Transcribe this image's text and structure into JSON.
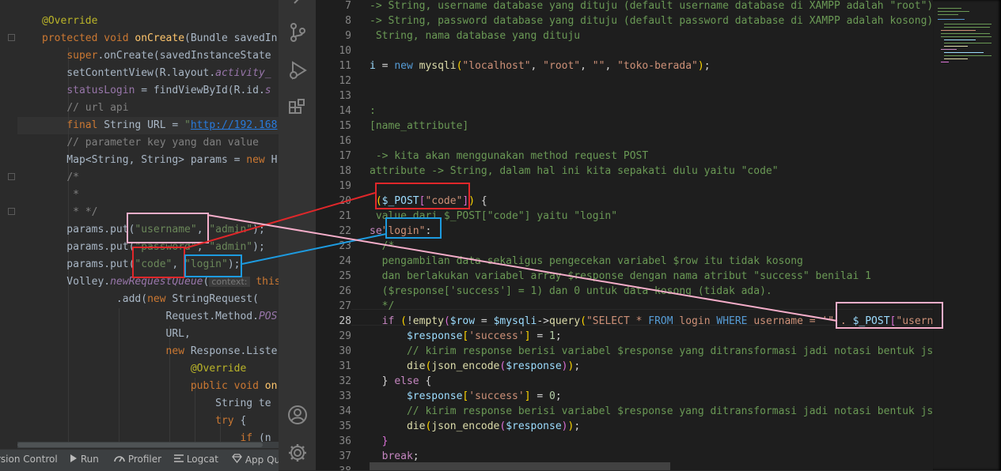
{
  "left_editor": {
    "lines": [
      {
        "segments": [
          [
            "l-ann",
            "@Override"
          ]
        ]
      },
      {
        "segments": [
          [
            "l-kw",
            "protected void "
          ],
          [
            "l-fn",
            "onCreate"
          ],
          [
            "",
            "(Bundle savedIn"
          ]
        ]
      },
      {
        "segments": [
          [
            "",
            "    "
          ],
          [
            "l-kw",
            "super"
          ],
          [
            "",
            ".onCreate(savedInstanceState"
          ]
        ]
      },
      {
        "segments": [
          [
            "",
            "    setContentView(R.layout."
          ],
          [
            "l-it",
            "activity_"
          ]
        ]
      },
      {
        "segments": [
          [
            "",
            "    "
          ],
          [
            "l-fld",
            "statusLogin"
          ],
          [
            "",
            " = findViewById(R.id."
          ],
          [
            "l-it",
            "s"
          ]
        ]
      },
      {
        "segments": [
          [
            "",
            "    "
          ],
          [
            "l-cmt",
            "// url api"
          ]
        ]
      },
      {
        "segments": [
          [
            "",
            "    "
          ],
          [
            "l-kw",
            "final "
          ],
          [
            "",
            "String URL = "
          ],
          [
            "l-str",
            "\""
          ],
          [
            "l-url",
            "http://192.168"
          ]
        ]
      },
      {
        "segments": [
          [
            "",
            "    "
          ],
          [
            "l-cmt",
            "// parameter key yang dan value"
          ]
        ]
      },
      {
        "segments": [
          [
            "",
            "    Map<String, String> params = "
          ],
          [
            "l-kw",
            "new "
          ],
          [
            "",
            "H"
          ]
        ]
      },
      {
        "segments": [
          [
            "",
            "    "
          ],
          [
            "l-cmt",
            "/*"
          ]
        ]
      },
      {
        "segments": [
          [
            "",
            "     "
          ],
          [
            "l-cmt",
            "*"
          ]
        ]
      },
      {
        "segments": [
          [
            "",
            "     "
          ],
          [
            "l-cmt",
            "* */"
          ]
        ]
      },
      {
        "segments": [
          [
            "",
            "    params.put("
          ],
          [
            "l-str",
            "\"username\""
          ],
          [
            "",
            ", "
          ],
          [
            "l-str",
            "\"admin\""
          ],
          [
            "",
            ");"
          ]
        ]
      },
      {
        "segments": [
          [
            "",
            "    params.put("
          ],
          [
            "l-str",
            "\"password\""
          ],
          [
            "",
            ", "
          ],
          [
            "l-str",
            "\"admin\""
          ],
          [
            "",
            ");"
          ]
        ]
      },
      {
        "segments": [
          [
            "",
            "    params.put("
          ],
          [
            "l-str",
            "\"code\""
          ],
          [
            "",
            ", "
          ],
          [
            "l-str",
            "\"login\""
          ],
          [
            "",
            ");"
          ]
        ]
      },
      {
        "segments": [
          [
            "",
            "    Volley."
          ],
          [
            "l-it",
            "newRequestQueue"
          ],
          [
            "",
            "("
          ],
          [
            "l-hint",
            "context:"
          ],
          [
            "",
            " "
          ],
          [
            "l-kw",
            "this"
          ]
        ]
      },
      {
        "segments": [
          [
            "",
            "            .add("
          ],
          [
            "l-kw",
            "new "
          ],
          [
            "",
            "StringRequest("
          ]
        ]
      },
      {
        "segments": [
          [
            "",
            "                    Request.Method."
          ],
          [
            "l-it",
            "POS"
          ]
        ]
      },
      {
        "segments": [
          [
            "",
            "                    URL,"
          ]
        ]
      },
      {
        "segments": [
          [
            "",
            "                    "
          ],
          [
            "l-kw",
            "new "
          ],
          [
            "",
            "Response.Liste"
          ]
        ]
      },
      {
        "segments": [
          [
            "",
            "                        "
          ],
          [
            "l-ann",
            "@Override"
          ]
        ]
      },
      {
        "segments": [
          [
            "",
            "                        "
          ],
          [
            "l-kw",
            "public void "
          ],
          [
            "l-fn",
            "on"
          ]
        ]
      },
      {
        "segments": [
          [
            "",
            "                            String te"
          ]
        ]
      },
      {
        "segments": [
          [
            "",
            "                            "
          ],
          [
            "l-kw",
            "try "
          ],
          [
            "",
            "{"
          ]
        ]
      },
      {
        "segments": [
          [
            "",
            "                                "
          ],
          [
            "l-kw",
            "if "
          ],
          [
            "",
            "(n"
          ]
        ]
      }
    ]
  },
  "bottom_bar": {
    "items": [
      {
        "label": "rsion Control",
        "icon": ""
      },
      {
        "label": "Run",
        "icon": "play-icon"
      },
      {
        "label": "Profiler",
        "icon": "profiler-icon"
      },
      {
        "label": "Logcat",
        "icon": "logcat-icon"
      },
      {
        "label": "App Qu",
        "icon": "app-quality-icon"
      }
    ]
  },
  "activity_bar": {
    "icons": [
      "explorer-icon",
      "source-control-icon",
      "run-debug-icon",
      "extensions-icon",
      "account-icon",
      "settings-gear-icon"
    ]
  },
  "right_editor": {
    "active_line": 28,
    "lines": [
      {
        "n": 7,
        "segments": [
          [
            "cmt",
            "-> String, username database yang dituju (default username database di XAMPP adalah \"root\")"
          ]
        ]
      },
      {
        "n": 8,
        "segments": [
          [
            "cmt",
            "-> String, password database yang dituju (default password database di XAMPP adalah kosong)"
          ]
        ]
      },
      {
        "n": 9,
        "segments": [
          [
            "cmt",
            " String, nama database yang dituju"
          ]
        ]
      },
      {
        "n": 10,
        "segments": []
      },
      {
        "n": 11,
        "segments": [
          [
            "var",
            "i"
          ],
          [
            "",
            " = "
          ],
          [
            "kw",
            "new "
          ],
          [
            "fn",
            "mysqli"
          ],
          [
            "brk1",
            "("
          ],
          [
            "str",
            "\"localhost\""
          ],
          [
            "",
            ", "
          ],
          [
            "str",
            "\"root\""
          ],
          [
            "",
            ", "
          ],
          [
            "str",
            "\"\""
          ],
          [
            "",
            ", "
          ],
          [
            "str",
            "\"toko-berada\""
          ],
          [
            "brk1",
            ")"
          ],
          [
            "",
            ";"
          ]
        ]
      },
      {
        "n": 12,
        "segments": []
      },
      {
        "n": 13,
        "segments": []
      },
      {
        "n": 14,
        "segments": [
          [
            "cmt",
            ":"
          ]
        ]
      },
      {
        "n": 15,
        "segments": [
          [
            "cmt",
            "[name_attribute]"
          ]
        ]
      },
      {
        "n": 16,
        "segments": []
      },
      {
        "n": 17,
        "segments": [
          [
            "cmt",
            " -> kita akan menggunakan method request POST"
          ]
        ]
      },
      {
        "n": 18,
        "segments": [
          [
            "cmt",
            "attribute -> String, dalam hal ini kita sepakati dulu yaitu \"code\""
          ]
        ]
      },
      {
        "n": 19,
        "segments": []
      },
      {
        "n": 20,
        "segments": [
          [
            "brk1",
            " ("
          ],
          [
            "var",
            "$_POST"
          ],
          [
            "brk2",
            "["
          ],
          [
            "str",
            "\"code\""
          ],
          [
            "brk2",
            "]"
          ],
          [
            "brk1",
            ")"
          ],
          [
            "",
            " {"
          ]
        ]
      },
      {
        "n": 21,
        "segments": [
          [
            "cmt",
            " value dari $_POST[\"code\"] yaitu \"login\""
          ]
        ]
      },
      {
        "n": 22,
        "segments": [
          [
            "kw2",
            "se"
          ],
          [
            "",
            ""
          ],
          [
            "str",
            "\"login\""
          ],
          [
            "",
            ":"
          ]
        ]
      },
      {
        "n": 23,
        "segments": [
          [
            "cmt",
            "  /*"
          ]
        ]
      },
      {
        "n": 24,
        "segments": [
          [
            "cmt",
            "  pengambilan data sekaligus pengecekan variabel $row itu tidak kosong"
          ]
        ]
      },
      {
        "n": 25,
        "segments": [
          [
            "cmt",
            "  dan berlakukan variabel array $response dengan nama atribut \"success\" benilai 1"
          ]
        ]
      },
      {
        "n": 26,
        "segments": [
          [
            "cmt",
            "  ($response['success'] = 1) dan 0 untuk data kosong (tidak ada)."
          ]
        ]
      },
      {
        "n": 27,
        "segments": [
          [
            "cmt",
            "  */"
          ]
        ]
      },
      {
        "n": 28,
        "segments": [
          [
            "",
            "  "
          ],
          [
            "kw2",
            "if "
          ],
          [
            "brk1",
            "("
          ],
          [
            "",
            "!"
          ],
          [
            "fn",
            "empty"
          ],
          [
            "brk2",
            "("
          ],
          [
            "var",
            "$row"
          ],
          [
            "",
            " = "
          ],
          [
            "var",
            "$mysqli"
          ],
          [
            "",
            "->"
          ],
          [
            "fn",
            "query"
          ],
          [
            "brk1",
            "("
          ],
          [
            "str",
            "\"SELECT * "
          ],
          [
            "kw",
            "FROM "
          ],
          [
            "str",
            "login "
          ],
          [
            "kw",
            "WHERE "
          ],
          [
            "str",
            "username = '\" . "
          ],
          [
            "var",
            "$_POST"
          ],
          [
            "brk2",
            "["
          ],
          [
            "str",
            "\"usernam"
          ]
        ]
      },
      {
        "n": 29,
        "segments": [
          [
            "",
            "      "
          ],
          [
            "var",
            "$response"
          ],
          [
            "brk1",
            "["
          ],
          [
            "str",
            "'success'"
          ],
          [
            "brk1",
            "]"
          ],
          [
            "",
            " = "
          ],
          [
            "num",
            "1"
          ],
          [
            "",
            ";"
          ]
        ]
      },
      {
        "n": 30,
        "segments": [
          [
            "",
            "      "
          ],
          [
            "cmt",
            "// kirim response berisi variabel $response yang ditransformasi jadi notasi bentuk json"
          ]
        ]
      },
      {
        "n": 31,
        "segments": [
          [
            "",
            "      "
          ],
          [
            "fn",
            "die"
          ],
          [
            "brk1",
            "("
          ],
          [
            "fn",
            "json_encode"
          ],
          [
            "brk2",
            "("
          ],
          [
            "var",
            "$response"
          ],
          [
            "brk2",
            ")"
          ],
          [
            "brk1",
            ")"
          ],
          [
            "",
            ";"
          ]
        ]
      },
      {
        "n": 32,
        "segments": [
          [
            "",
            "  } "
          ],
          [
            "kw2",
            "else "
          ],
          [
            "",
            "{"
          ]
        ]
      },
      {
        "n": 33,
        "segments": [
          [
            "",
            "      "
          ],
          [
            "var",
            "$response"
          ],
          [
            "brk1",
            "["
          ],
          [
            "str",
            "'success'"
          ],
          [
            "brk1",
            "]"
          ],
          [
            "",
            " = "
          ],
          [
            "num",
            "0"
          ],
          [
            "",
            ";"
          ]
        ]
      },
      {
        "n": 34,
        "segments": [
          [
            "",
            "      "
          ],
          [
            "cmt",
            "// kirim response berisi variabel $response yang ditransformasi jadi notasi bentuk json"
          ]
        ]
      },
      {
        "n": 35,
        "segments": [
          [
            "",
            "      "
          ],
          [
            "fn",
            "die"
          ],
          [
            "brk1",
            "("
          ],
          [
            "fn",
            "json_encode"
          ],
          [
            "brk2",
            "("
          ],
          [
            "var",
            "$response"
          ],
          [
            "brk2",
            ")"
          ],
          [
            "brk1",
            ")"
          ],
          [
            "",
            ";"
          ]
        ]
      },
      {
        "n": 36,
        "segments": [
          [
            "",
            "  "
          ],
          [
            "brk2",
            "}"
          ]
        ]
      },
      {
        "n": 37,
        "segments": [
          [
            "",
            "  "
          ],
          [
            "kw2",
            "break"
          ],
          [
            "",
            ";"
          ]
        ]
      },
      {
        "n": 38,
        "segments": [
          [
            "kw2",
            "efault"
          ],
          [
            "",
            ":"
          ]
        ]
      }
    ]
  },
  "colors": {
    "annotation_red": "#e0272a",
    "annotation_blue": "#1d9be0",
    "annotation_pink": "#f6aeca"
  }
}
